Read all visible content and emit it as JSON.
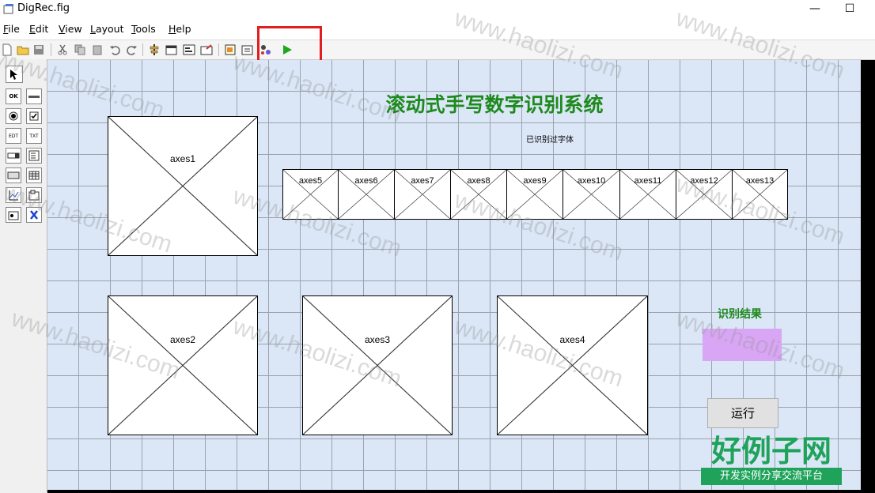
{
  "window": {
    "title": "DigRec.fig",
    "minimize": "—",
    "maximize": "☐"
  },
  "menu": [
    {
      "key": "F",
      "rest": "ile"
    },
    {
      "key": "E",
      "rest": "dit"
    },
    {
      "key": "V",
      "rest": "iew"
    },
    {
      "key": "L",
      "rest": "ayout"
    },
    {
      "key": "T",
      "rest": "ools"
    },
    {
      "key": "H",
      "rest": "elp"
    }
  ],
  "toolbar": [
    "new-icon",
    "open-icon",
    "save-icon",
    "cut-icon",
    "copy-icon",
    "paste-icon",
    "undo-icon",
    "redo-icon",
    "align-icon",
    "menu-editor-icon",
    "tab-order-icon",
    "toolbar-editor-icon",
    "mfile-icon",
    "property-inspector-icon",
    "object-browser-icon",
    "run-icon"
  ],
  "palette": [
    [
      "select-icon"
    ],
    [
      "pushbutton-icon",
      "slider-icon"
    ],
    [
      "radiobutton-icon",
      "checkbox-icon"
    ],
    [
      "edittext-icon",
      "statictext-icon"
    ],
    [
      "popupmenu-icon",
      "listbox-icon"
    ],
    [
      "togglebutton-icon",
      "table-icon"
    ],
    [
      "axes-icon",
      "panel-icon"
    ],
    [
      "buttongroup-icon",
      "activex-icon"
    ]
  ],
  "palette_text": {
    "ok": "OK",
    "edt": "EDT",
    "txt": "TXT"
  },
  "figure": {
    "title": "滚动式手写数字识别系统",
    "subtitle": "已识别过字体",
    "result_label": "识别结果",
    "run_button": "运行",
    "axes_large": [
      "axes1",
      "axes2",
      "axes3",
      "axes4"
    ],
    "axes_small": [
      "axes5",
      "axes6",
      "axes7",
      "axes8",
      "axes9",
      "axes10",
      "axes11",
      "axes12",
      "axes13"
    ],
    "result_color": "#d9a6f5",
    "title_color": "#1e8a1e"
  },
  "watermark": "www.haolizi.com",
  "logo": {
    "main": "好例子网",
    "sub": "开发实例分享交流平台",
    "color": "#1fa35b"
  },
  "highlight_color": "#e02020"
}
